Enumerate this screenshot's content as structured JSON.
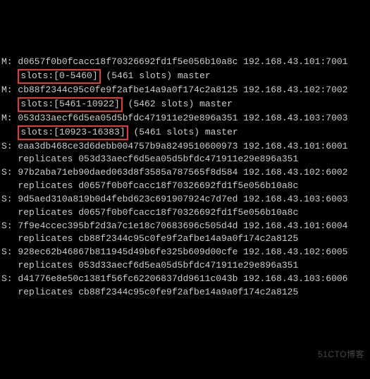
{
  "lines": [
    {
      "pre": "M: d0657f0b0fcacc18f70326692fd1f5e056b10a8c 192.168.43.101:7001"
    },
    {
      "pre": "   ",
      "hl": "slots:[0-5460]",
      "post": " (5461 slots) master"
    },
    {
      "pre": "M: cb88f2344c95c0fe9f2afbe14a9a0f174c2a8125 192.168.43.102:7002"
    },
    {
      "pre": "   ",
      "hl": "slots:[5461-10922]",
      "post": " (5462 slots) master"
    },
    {
      "pre": "M: 053d33aecf6d5ea05d5bfdc471911e29e896a351 192.168.43.103:7003"
    },
    {
      "pre": "   ",
      "hl": "slots:[10923-16383]",
      "post": " (5461 slots) master"
    },
    {
      "pre": "S: eaa3db468ce3d6debb004757b9a8249510600973 192.168.43.101:6001"
    },
    {
      "pre": "   replicates 053d33aecf6d5ea05d5bfdc471911e29e896a351"
    },
    {
      "pre": "S: 97b2aba71eb90daed063d8f3585a787565f8d584 192.168.43.102:6002"
    },
    {
      "pre": "   replicates d0657f0b0fcacc18f70326692fd1f5e056b10a8c"
    },
    {
      "pre": "S: 9d5aed310a819b0d4febd623c691907924c7d7ed 192.168.43.103:6003"
    },
    {
      "pre": "   replicates d0657f0b0fcacc18f70326692fd1f5e056b10a8c"
    },
    {
      "pre": "S: 7f9e4ccec395bf2d3a7c1e18c70683696c505d4d 192.168.43.101:6004"
    },
    {
      "pre": "   replicates cb88f2344c95c0fe9f2afbe14a9a0f174c2a8125"
    },
    {
      "pre": "S: 928ec62b46867b811945d49b6fe325b609d00cfe 192.168.43.102:6005"
    },
    {
      "pre": "   replicates 053d33aecf6d5ea05d5bfdc471911e29e896a351"
    },
    {
      "pre": "S: d41776e8e50c1381f56fc62206837dd9611c043b 192.168.43.103:6006"
    },
    {
      "pre": "   replicates cb88f2344c95c0fe9f2afbe14a9a0f174c2a8125"
    }
  ],
  "watermark": "51CTO博客"
}
